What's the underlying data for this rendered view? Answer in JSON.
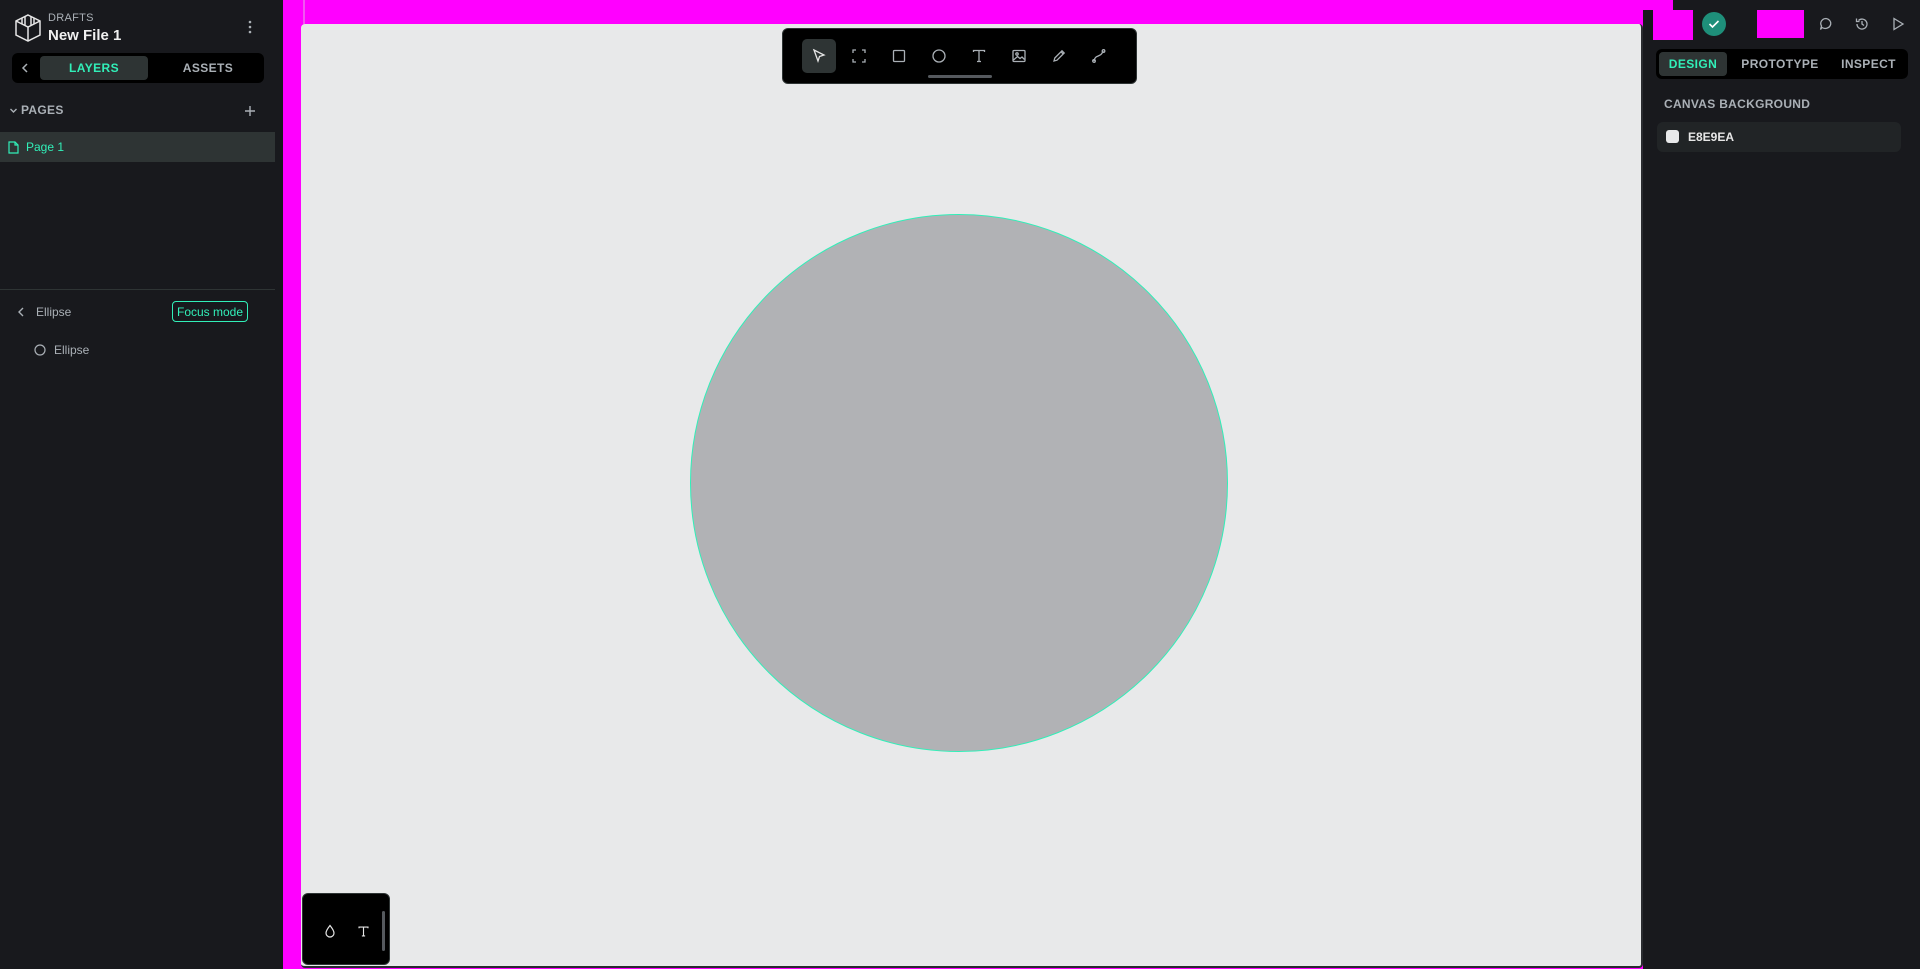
{
  "app": {
    "location_label": "DRAFTS",
    "file_name": "New File 1"
  },
  "sidebar": {
    "tabs": [
      {
        "label": "LAYERS",
        "active": true
      },
      {
        "label": "ASSETS",
        "active": false
      }
    ],
    "pages_header": "PAGES",
    "pages": [
      {
        "label": "Page 1",
        "selected": true
      }
    ],
    "focus": {
      "title": "Ellipse",
      "badge": "Focus mode",
      "layers": [
        {
          "label": "Ellipse",
          "icon": "ellipse-icon"
        }
      ]
    }
  },
  "toolbar": {
    "tools": [
      {
        "name": "move",
        "icon": "pointer-icon",
        "active": true
      },
      {
        "name": "board",
        "icon": "board-icon",
        "active": false
      },
      {
        "name": "rectangle",
        "icon": "rectangle-icon",
        "active": false
      },
      {
        "name": "ellipse",
        "icon": "ellipse-icon",
        "active": false
      },
      {
        "name": "text",
        "icon": "text-icon",
        "active": false
      },
      {
        "name": "image",
        "icon": "image-icon",
        "active": false
      },
      {
        "name": "curve",
        "icon": "pencil-icon",
        "active": false
      },
      {
        "name": "path",
        "icon": "path-icon",
        "active": false
      }
    ]
  },
  "mini_toolbar": {
    "tools": [
      {
        "name": "color-palette",
        "icon": "droplet-icon"
      },
      {
        "name": "typography",
        "icon": "text-icon"
      }
    ]
  },
  "canvas": {
    "background": "#E8E9EA",
    "shape_fill": "#B1B2B5",
    "selection_color": "#31EFB8"
  },
  "right_panel": {
    "tabs": [
      {
        "label": "DESIGN",
        "active": true
      },
      {
        "label": "PROTOTYPE",
        "active": false
      },
      {
        "label": "INSPECT",
        "active": false
      }
    ],
    "canvas_background_title": "CANVAS BACKGROUND",
    "canvas_background_value": "E8E9EA"
  },
  "header_icons": [
    "comments-icon",
    "history-icon",
    "play-icon"
  ],
  "colors": {
    "accent": "#31EFB8",
    "panel": "#18191D",
    "highlight": "#FF00FF"
  }
}
